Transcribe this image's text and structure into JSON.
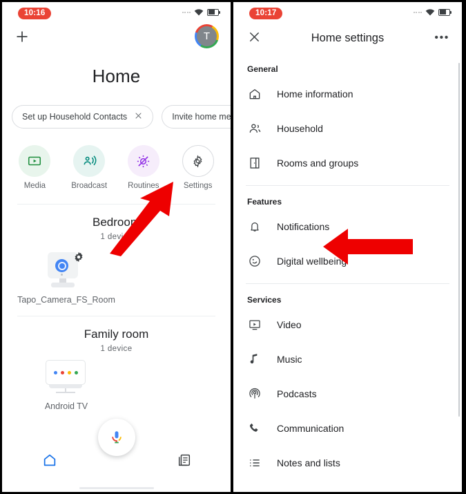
{
  "left_screen": {
    "status_bar": {
      "time": "10:16",
      "wifi_icon": "wifi-icon",
      "battery_icon": "battery-icon",
      "signal_icon": "signal-dots-icon"
    },
    "top_bar": {
      "add_icon": "plus-icon",
      "avatar_initial": "T"
    },
    "page_title": "Home",
    "chips": [
      {
        "label": "Set up Household Contacts",
        "has_dismiss": true,
        "dismiss_icon": "close-icon"
      },
      {
        "label": "Invite home me",
        "has_dismiss": false
      }
    ],
    "shortcuts": [
      {
        "label": "Media",
        "icon": "media-play-icon",
        "color": "#1e8e3e"
      },
      {
        "label": "Broadcast",
        "icon": "broadcast-icon",
        "color": "#00897b"
      },
      {
        "label": "Routines",
        "icon": "routines-icon",
        "color": "#9334e6"
      },
      {
        "label": "Settings",
        "icon": "gear-icon",
        "color": "#3c4043"
      }
    ],
    "rooms": [
      {
        "name": "Bedroom",
        "device_count": "1 device",
        "devices": [
          {
            "name": "Tapo_Camera_FS_Room",
            "icon": "camera-icon"
          }
        ]
      },
      {
        "name": "Family room",
        "device_count": "1 device",
        "devices": [
          {
            "name": "Android TV",
            "icon": "tv-icon"
          }
        ]
      }
    ],
    "bottom_nav": [
      {
        "name": "home-tab",
        "icon": "home-icon",
        "active": true
      },
      {
        "name": "feed-tab",
        "icon": "feed-icon",
        "active": false
      }
    ],
    "assistant_fab": {
      "icon": "google-mic-icon"
    }
  },
  "right_screen": {
    "status_bar": {
      "time": "10:17",
      "wifi_icon": "wifi-icon",
      "battery_icon": "battery-icon",
      "signal_icon": "signal-dots-icon"
    },
    "app_bar": {
      "close_icon": "close-icon",
      "title": "Home settings",
      "overflow_icon": "more-options-icon",
      "overflow_label": "•••"
    },
    "sections": [
      {
        "heading": "General",
        "items": [
          {
            "label": "Home information",
            "icon": "home-outline-icon"
          },
          {
            "label": "Household",
            "icon": "people-icon"
          },
          {
            "label": "Rooms and groups",
            "icon": "door-icon"
          }
        ]
      },
      {
        "heading": "Features",
        "items": [
          {
            "label": "Notifications",
            "icon": "bell-icon",
            "highlighted": true
          },
          {
            "label": "Digital wellbeing",
            "icon": "wellbeing-icon"
          }
        ]
      },
      {
        "heading": "Services",
        "items": [
          {
            "label": "Video",
            "icon": "video-icon"
          },
          {
            "label": "Music",
            "icon": "music-note-icon"
          },
          {
            "label": "Podcasts",
            "icon": "podcast-icon"
          },
          {
            "label": "Communication",
            "icon": "phone-icon"
          },
          {
            "label": "Notes and lists",
            "icon": "list-icon"
          }
        ]
      }
    ],
    "scrollbar": {
      "name": "vertical-scrollbar"
    }
  },
  "annotations": {
    "arrow_color": "#ee0000",
    "left_arrow_points_to": "Settings",
    "right_arrow_points_to": "Notifications"
  }
}
